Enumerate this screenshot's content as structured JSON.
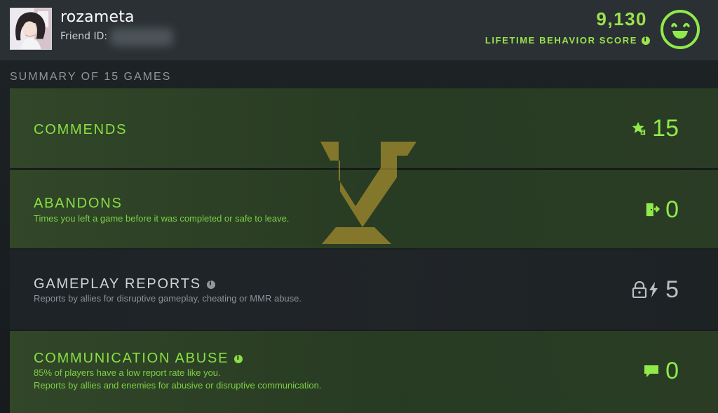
{
  "profile": {
    "username": "rozameta",
    "friend_id_label": "Friend ID:"
  },
  "behavior": {
    "score": "9,130",
    "label": "LIFETIME BEHAVIOR SCORE"
  },
  "summary": {
    "title": "SUMMARY OF 15 GAMES"
  },
  "cards": [
    {
      "title": "COMMENDS",
      "value": "15",
      "icon": "commend-star-icon"
    },
    {
      "title": "ABANDONS",
      "subtitle": "Times you left a game before it was completed or safe to leave.",
      "value": "0",
      "icon": "door-exit-icon"
    },
    {
      "title": "GAMEPLAY REPORTS",
      "subtitle": "Reports by allies for disruptive gameplay, cheating or MMR abuse.",
      "value": "5",
      "icon": "lock-lightning-icon"
    },
    {
      "title": "COMMUNICATION ABUSE",
      "subtitle_line1": "85% of players have a low report rate like you.",
      "subtitle_line2": "Reports by allies and enemies for abusive or disruptive communication.",
      "value": "0",
      "icon": "chat-bubble-icon"
    }
  ],
  "colors": {
    "accent_green": "#8fea4a",
    "header_bg": "#2a3034",
    "panel_good": "#2f4525",
    "panel_neutral": "#1f2427",
    "muted_text": "#8e979b",
    "emblem_gold": "#c6a437"
  }
}
